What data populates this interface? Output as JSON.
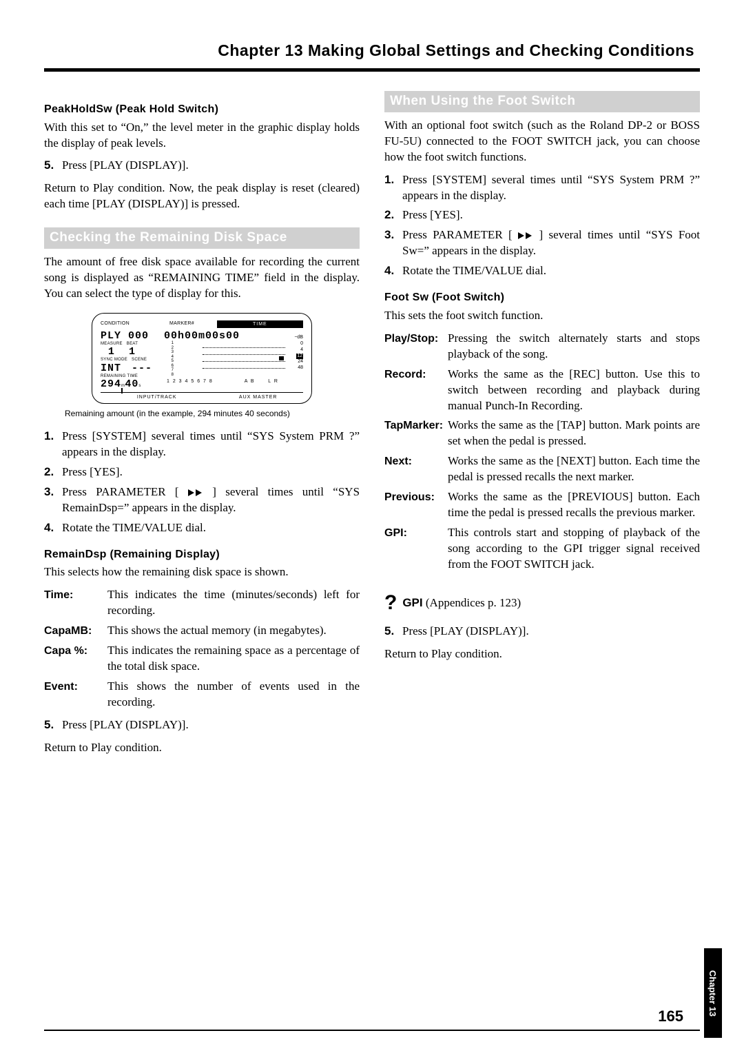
{
  "header": {
    "title": "Chapter 13 Making Global Settings and Checking Conditions"
  },
  "left": {
    "peakhold": {
      "heading": "PeakHoldSw (Peak Hold Switch)",
      "body": "With this set to “On,” the level meter in the graphic display holds the display of peak levels."
    },
    "step5": {
      "num": "5.",
      "text": "Press [PLAY (DISPLAY)]."
    },
    "step5_after": "Return to Play condition. Now, the peak display is reset (cleared) each time [PLAY (DISPLAY)] is pressed.",
    "disk_section_title": "Checking the Remaining Disk Space",
    "disk_intro": "The amount of free disk space available for recording the current song is displayed as “REMAINING TIME” field in the display. You can select the type of display for this.",
    "fig": {
      "condition": "CONDITION",
      "marker": "MARKER#",
      "time": "TIME",
      "ply": "PLY 000",
      "timecode": "00h00m00s00",
      "measure_lbl": "MEASURE",
      "beat_lbl": "BEAT",
      "measure": "1",
      "beat": "1",
      "syncmode_lbl": "SYNC MODE",
      "scene_lbl": "SCENE",
      "sync": "INT",
      "scene": "---",
      "remtime_lbl": "REMAINING TIME",
      "remtime": "294",
      "rem_m": "m",
      "rem_s": "40",
      "rem_s_unit": "s",
      "tracks": "1 2 3 4 5 6 7 8",
      "ab": "A B",
      "lr": "L R",
      "input_track": "INPUT/TRACK",
      "aux_master": "AUX  MASTER",
      "db": "−dB",
      "db0": "0",
      "db4": "4",
      "db12": "12",
      "db24": "24",
      "db48": "48",
      "meterscale": [
        "1",
        "2",
        "3",
        "4",
        "5",
        "6",
        "7",
        "8"
      ],
      "caption": "Remaining amount (in the example, 294 minutes 40 seconds)"
    },
    "steps_disk": [
      {
        "num": "1.",
        "text": "Press [SYSTEM] several times until “SYS System PRM ?” appears in the display."
      },
      {
        "num": "2.",
        "text": "Press [YES]."
      },
      {
        "num": "3.",
        "text_a": "Press PARAMETER [",
        "text_b": "] several times until “SYS RemainDsp=” appears in the display."
      },
      {
        "num": "4.",
        "text": "Rotate the TIME/VALUE dial."
      }
    ],
    "remaindsp_head": "RemainDsp (Remaining Display)",
    "remaindsp_body": "This selects how the remaining disk space is shown.",
    "remaindsp_defs": [
      {
        "term": "Time:",
        "desc": "This indicates the time (minutes/seconds) left for recording."
      },
      {
        "term": "CapaMB:",
        "desc": "This shows the actual memory (in megabytes)."
      },
      {
        "term": "Capa %:",
        "desc": "This indicates the remaining space as a percentage of the total disk space."
      },
      {
        "term": "Event:",
        "desc": "This shows the number of events used in the recording."
      }
    ],
    "step5b": {
      "num": "5.",
      "text": "Press [PLAY (DISPLAY)]."
    },
    "step5b_after": "Return to Play condition."
  },
  "right": {
    "foot_section_title": "When Using the Foot Switch",
    "foot_intro": "With an optional foot switch (such as the Roland DP-2 or BOSS FU-5U) connected to the FOOT SWITCH jack, you can choose how the foot switch functions.",
    "steps_foot": [
      {
        "num": "1.",
        "text": "Press [SYSTEM] several times until “SYS System PRM ?” appears in the display."
      },
      {
        "num": "2.",
        "text": "Press [YES]."
      },
      {
        "num": "3.",
        "text_a": "Press PARAMETER [",
        "text_b": "] several times until “SYS Foot Sw=” appears in the display."
      },
      {
        "num": "4.",
        "text": "Rotate the TIME/VALUE dial."
      }
    ],
    "footsw_head": "Foot Sw (Foot Switch)",
    "footsw_body": "This sets the foot switch function.",
    "footsw_defs": [
      {
        "term": "Play/Stop:",
        "desc": "Pressing the switch alternately starts and stops playback of the song."
      },
      {
        "term": "Record:",
        "desc": "Works the same as the [REC] button. Use this to switch between recording and playback during manual Punch-In Recording."
      },
      {
        "term": "TapMarker:",
        "desc": "Works the same as the [TAP] button. Mark points are set when the pedal is pressed."
      },
      {
        "term": "Next:",
        "desc": "Works the same as the [NEXT] button. Each time the pedal is pressed recalls the next marker."
      },
      {
        "term": "Previous:",
        "desc": "Works the same as the [PREVIOUS] button. Each time the pedal is pressed recalls the previous marker."
      },
      {
        "term": "GPI:",
        "desc": "This controls start and stopping of playback of the song according to the GPI trigger signal received from the FOOT SWITCH jack."
      }
    ],
    "note": {
      "label": "GPI",
      "text": " (Appendices p. 123)"
    },
    "step5": {
      "num": "5.",
      "text": "Press [PLAY (DISPLAY)]."
    },
    "step5_after": "Return to Play condition."
  },
  "footer": {
    "page": "165",
    "sidetab": "Chapter 13"
  }
}
